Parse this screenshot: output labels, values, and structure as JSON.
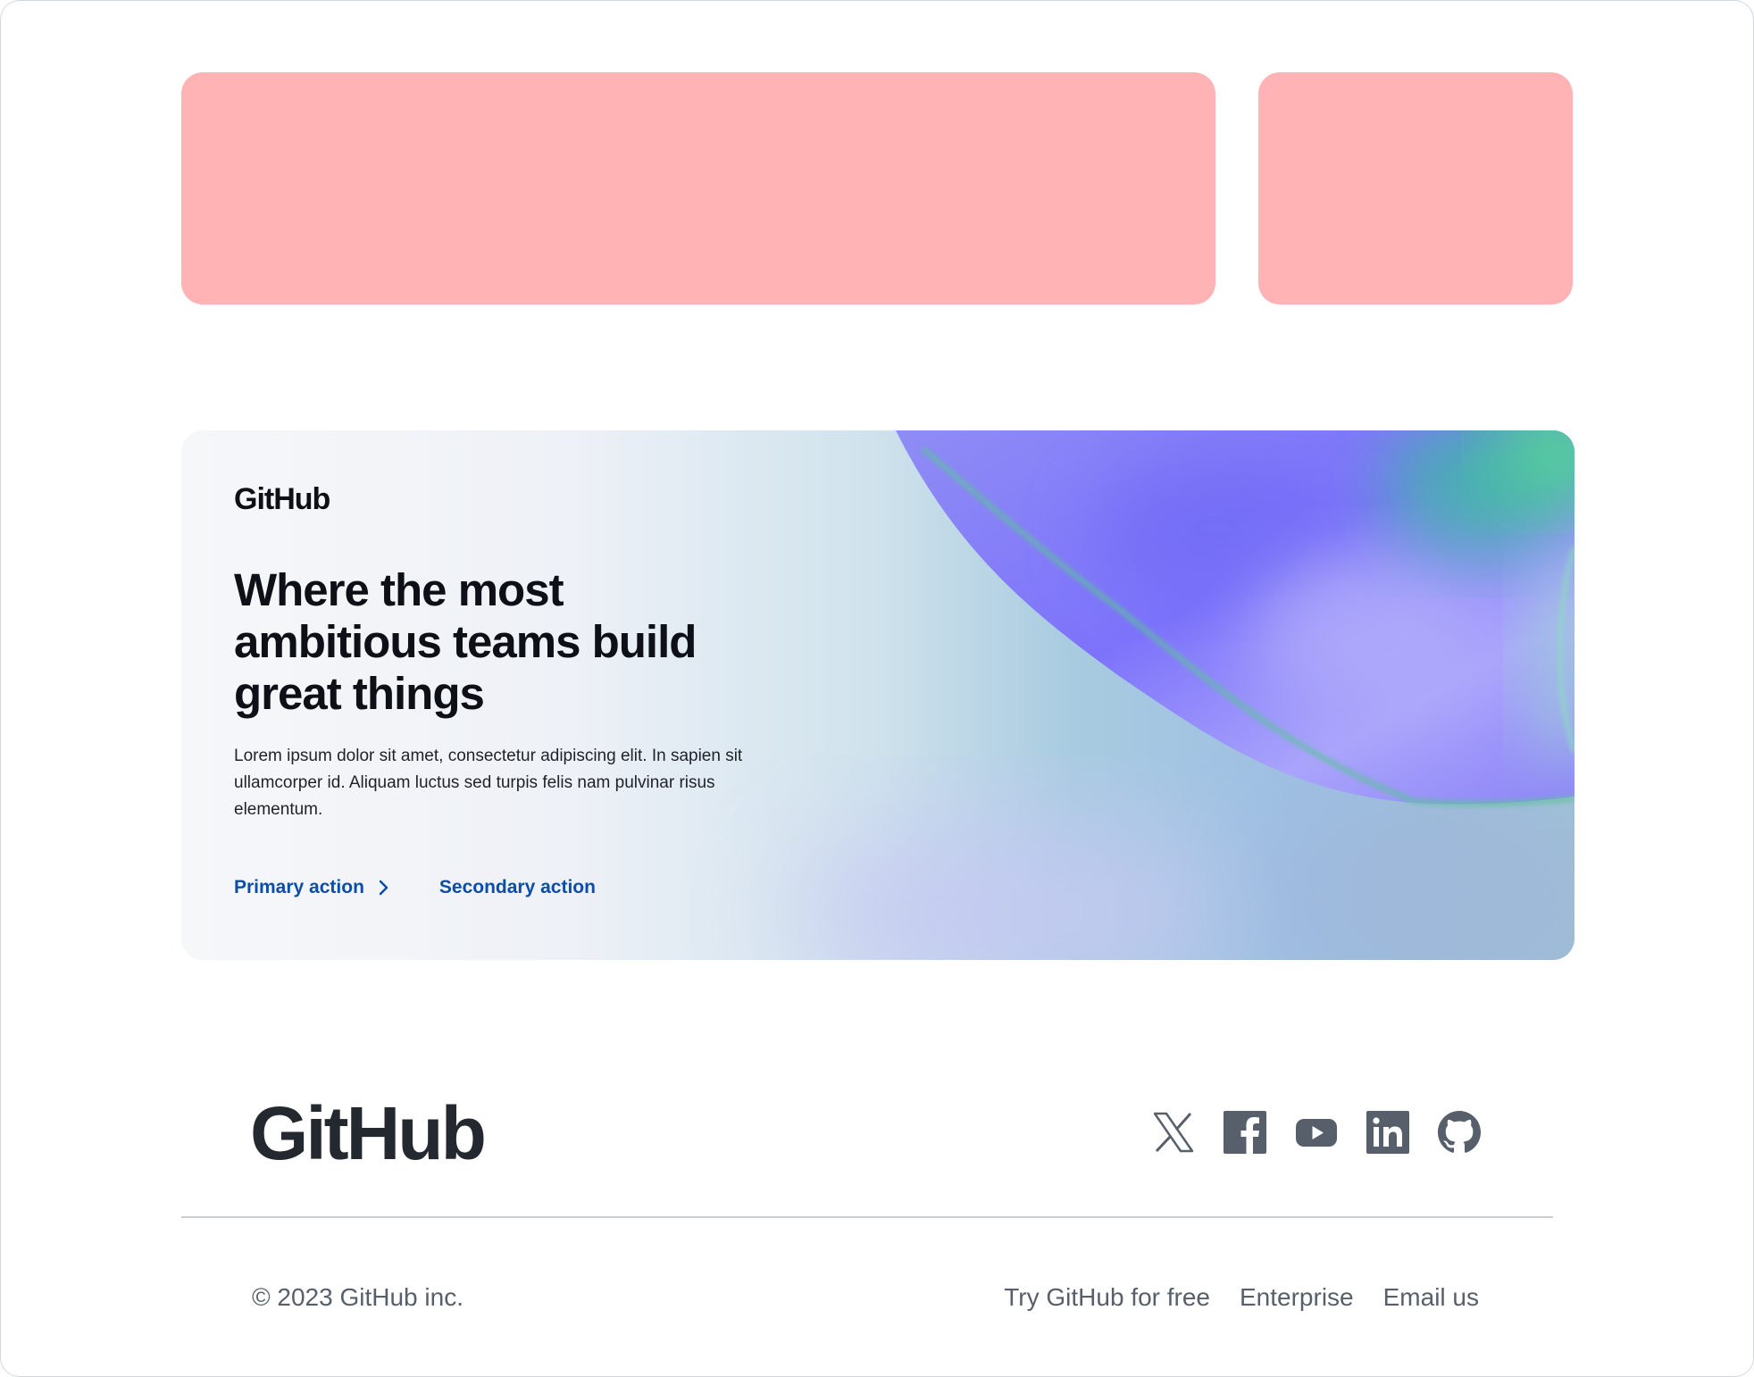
{
  "placeholders": [
    "main-banner-placeholder",
    "side-banner-placeholder"
  ],
  "hero": {
    "logo_text": "GitHub",
    "title": "Where the most ambitious teams build great things",
    "body": "Lorem ipsum dolor sit amet, consectetur adipiscing elit. In sapien sit ullamcorper id. Aliquam luctus sed turpis felis nam pulvinar risus elementum.",
    "primary_action": "Primary action",
    "secondary_action": "Secondary action"
  },
  "footer": {
    "logo_text": "GitHub",
    "socials": [
      "x-icon",
      "facebook-icon",
      "youtube-icon",
      "linkedin-icon",
      "github-icon"
    ],
    "copyright": "© 2023 GitHub inc.",
    "links": [
      "Try GitHub for free",
      "Enterprise",
      "Email us"
    ]
  },
  "colors": {
    "placeholder": "#ffb3b5",
    "link": "#0a4ea8",
    "text_dark": "#0d1117",
    "footer_text": "#57606a",
    "icon": "#57606a"
  }
}
